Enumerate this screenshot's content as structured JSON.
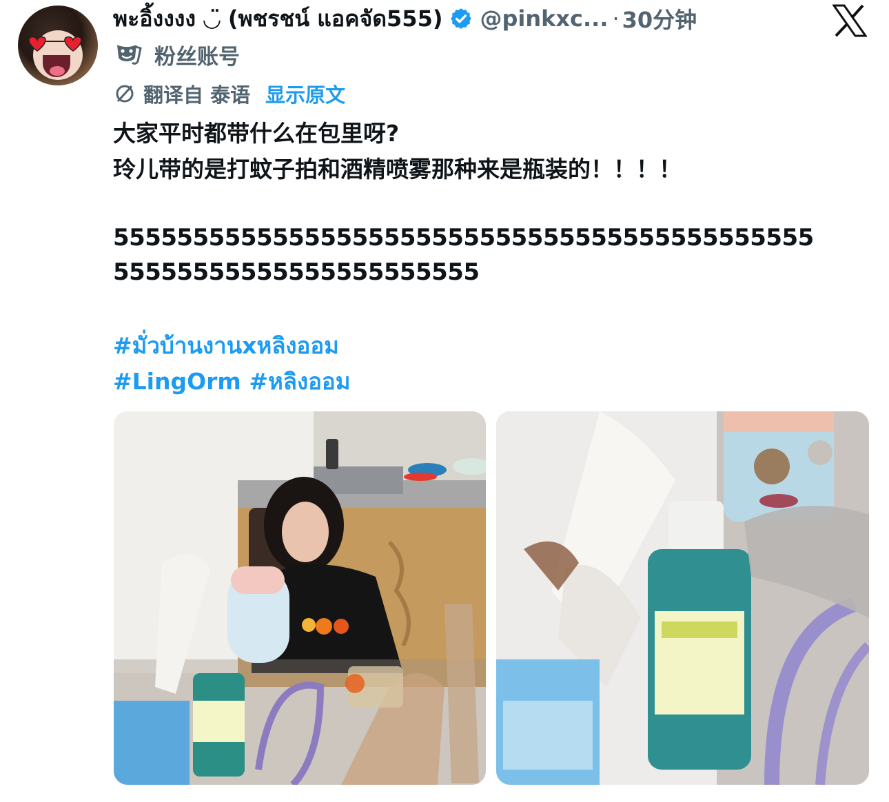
{
  "tweet": {
    "display_name": "พะอิ้งงงง ◡̈ (พชรชน์ แอคจัด555)",
    "handle": "@pinkxc...",
    "separator": "·",
    "timestamp": "30分钟",
    "fan_account_label": "粉丝账号",
    "translated_from": "翻译自 泰语",
    "show_original": "显示原文",
    "text_line1": "大家平时都带什么在包里呀?",
    "text_line2": "玲儿带的是打蚊子拍和酒精喷雾那种来是瓶装的！！！！",
    "text_line3": "55555555555555555555555555555555555555555555",
    "text_line4": "55555555555555555555555",
    "hashtag1": "#มั่วบ้านงานxหลิงออม",
    "hashtag2": "#LingOrm",
    "hashtag3": "#หลิงออม"
  },
  "icons": {
    "avatar": "avatar-photo",
    "verified": "verified-badge-icon",
    "platform": "x-logo-icon",
    "fan_account": "theater-mask-icon",
    "translate": "translate-icon"
  },
  "colors": {
    "accent": "#1d9bf0",
    "secondary_text": "#536471",
    "primary_text": "#0f1419"
  }
}
